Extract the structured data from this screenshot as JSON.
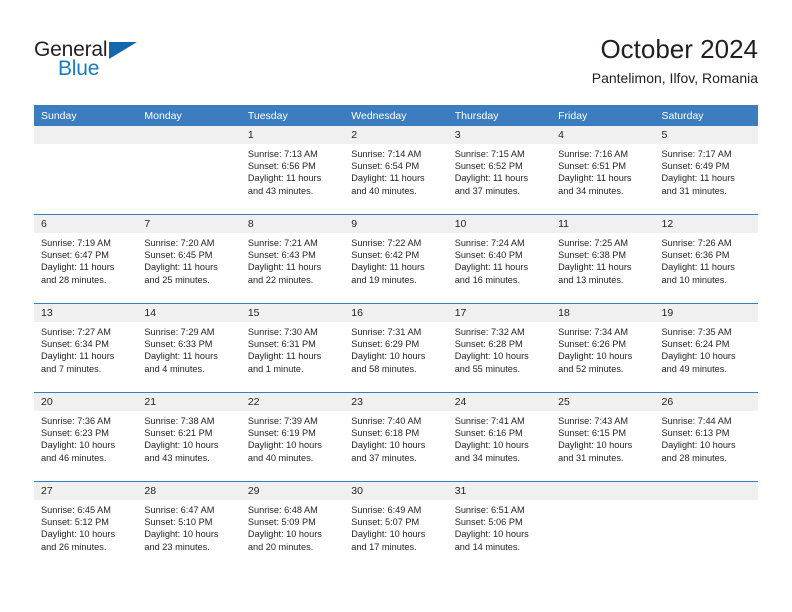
{
  "brand": {
    "name_part1": "General",
    "name_part2": "Blue",
    "accent_color": "#1267ad",
    "text_color": "#231f20"
  },
  "header": {
    "title": "October 2024",
    "subtitle": "Pantelimon, Ilfov, Romania"
  },
  "calendar": {
    "header_bg": "#3b7dbf",
    "daynum_bg": "#f0f0f0",
    "weekdays": [
      "Sunday",
      "Monday",
      "Tuesday",
      "Wednesday",
      "Thursday",
      "Friday",
      "Saturday"
    ],
    "weeks": [
      [
        {
          "day": "",
          "blank": true
        },
        {
          "day": "",
          "blank": true
        },
        {
          "day": "1",
          "sunrise": "Sunrise: 7:13 AM",
          "sunset": "Sunset: 6:56 PM",
          "daylight1": "Daylight: 11 hours",
          "daylight2": "and 43 minutes."
        },
        {
          "day": "2",
          "sunrise": "Sunrise: 7:14 AM",
          "sunset": "Sunset: 6:54 PM",
          "daylight1": "Daylight: 11 hours",
          "daylight2": "and 40 minutes."
        },
        {
          "day": "3",
          "sunrise": "Sunrise: 7:15 AM",
          "sunset": "Sunset: 6:52 PM",
          "daylight1": "Daylight: 11 hours",
          "daylight2": "and 37 minutes."
        },
        {
          "day": "4",
          "sunrise": "Sunrise: 7:16 AM",
          "sunset": "Sunset: 6:51 PM",
          "daylight1": "Daylight: 11 hours",
          "daylight2": "and 34 minutes."
        },
        {
          "day": "5",
          "sunrise": "Sunrise: 7:17 AM",
          "sunset": "Sunset: 6:49 PM",
          "daylight1": "Daylight: 11 hours",
          "daylight2": "and 31 minutes."
        }
      ],
      [
        {
          "day": "6",
          "sunrise": "Sunrise: 7:19 AM",
          "sunset": "Sunset: 6:47 PM",
          "daylight1": "Daylight: 11 hours",
          "daylight2": "and 28 minutes."
        },
        {
          "day": "7",
          "sunrise": "Sunrise: 7:20 AM",
          "sunset": "Sunset: 6:45 PM",
          "daylight1": "Daylight: 11 hours",
          "daylight2": "and 25 minutes."
        },
        {
          "day": "8",
          "sunrise": "Sunrise: 7:21 AM",
          "sunset": "Sunset: 6:43 PM",
          "daylight1": "Daylight: 11 hours",
          "daylight2": "and 22 minutes."
        },
        {
          "day": "9",
          "sunrise": "Sunrise: 7:22 AM",
          "sunset": "Sunset: 6:42 PM",
          "daylight1": "Daylight: 11 hours",
          "daylight2": "and 19 minutes."
        },
        {
          "day": "10",
          "sunrise": "Sunrise: 7:24 AM",
          "sunset": "Sunset: 6:40 PM",
          "daylight1": "Daylight: 11 hours",
          "daylight2": "and 16 minutes."
        },
        {
          "day": "11",
          "sunrise": "Sunrise: 7:25 AM",
          "sunset": "Sunset: 6:38 PM",
          "daylight1": "Daylight: 11 hours",
          "daylight2": "and 13 minutes."
        },
        {
          "day": "12",
          "sunrise": "Sunrise: 7:26 AM",
          "sunset": "Sunset: 6:36 PM",
          "daylight1": "Daylight: 11 hours",
          "daylight2": "and 10 minutes."
        }
      ],
      [
        {
          "day": "13",
          "sunrise": "Sunrise: 7:27 AM",
          "sunset": "Sunset: 6:34 PM",
          "daylight1": "Daylight: 11 hours",
          "daylight2": "and 7 minutes."
        },
        {
          "day": "14",
          "sunrise": "Sunrise: 7:29 AM",
          "sunset": "Sunset: 6:33 PM",
          "daylight1": "Daylight: 11 hours",
          "daylight2": "and 4 minutes."
        },
        {
          "day": "15",
          "sunrise": "Sunrise: 7:30 AM",
          "sunset": "Sunset: 6:31 PM",
          "daylight1": "Daylight: 11 hours",
          "daylight2": "and 1 minute."
        },
        {
          "day": "16",
          "sunrise": "Sunrise: 7:31 AM",
          "sunset": "Sunset: 6:29 PM",
          "daylight1": "Daylight: 10 hours",
          "daylight2": "and 58 minutes."
        },
        {
          "day": "17",
          "sunrise": "Sunrise: 7:32 AM",
          "sunset": "Sunset: 6:28 PM",
          "daylight1": "Daylight: 10 hours",
          "daylight2": "and 55 minutes."
        },
        {
          "day": "18",
          "sunrise": "Sunrise: 7:34 AM",
          "sunset": "Sunset: 6:26 PM",
          "daylight1": "Daylight: 10 hours",
          "daylight2": "and 52 minutes."
        },
        {
          "day": "19",
          "sunrise": "Sunrise: 7:35 AM",
          "sunset": "Sunset: 6:24 PM",
          "daylight1": "Daylight: 10 hours",
          "daylight2": "and 49 minutes."
        }
      ],
      [
        {
          "day": "20",
          "sunrise": "Sunrise: 7:36 AM",
          "sunset": "Sunset: 6:23 PM",
          "daylight1": "Daylight: 10 hours",
          "daylight2": "and 46 minutes."
        },
        {
          "day": "21",
          "sunrise": "Sunrise: 7:38 AM",
          "sunset": "Sunset: 6:21 PM",
          "daylight1": "Daylight: 10 hours",
          "daylight2": "and 43 minutes."
        },
        {
          "day": "22",
          "sunrise": "Sunrise: 7:39 AM",
          "sunset": "Sunset: 6:19 PM",
          "daylight1": "Daylight: 10 hours",
          "daylight2": "and 40 minutes."
        },
        {
          "day": "23",
          "sunrise": "Sunrise: 7:40 AM",
          "sunset": "Sunset: 6:18 PM",
          "daylight1": "Daylight: 10 hours",
          "daylight2": "and 37 minutes."
        },
        {
          "day": "24",
          "sunrise": "Sunrise: 7:41 AM",
          "sunset": "Sunset: 6:16 PM",
          "daylight1": "Daylight: 10 hours",
          "daylight2": "and 34 minutes."
        },
        {
          "day": "25",
          "sunrise": "Sunrise: 7:43 AM",
          "sunset": "Sunset: 6:15 PM",
          "daylight1": "Daylight: 10 hours",
          "daylight2": "and 31 minutes."
        },
        {
          "day": "26",
          "sunrise": "Sunrise: 7:44 AM",
          "sunset": "Sunset: 6:13 PM",
          "daylight1": "Daylight: 10 hours",
          "daylight2": "and 28 minutes."
        }
      ],
      [
        {
          "day": "27",
          "sunrise": "Sunrise: 6:45 AM",
          "sunset": "Sunset: 5:12 PM",
          "daylight1": "Daylight: 10 hours",
          "daylight2": "and 26 minutes."
        },
        {
          "day": "28",
          "sunrise": "Sunrise: 6:47 AM",
          "sunset": "Sunset: 5:10 PM",
          "daylight1": "Daylight: 10 hours",
          "daylight2": "and 23 minutes."
        },
        {
          "day": "29",
          "sunrise": "Sunrise: 6:48 AM",
          "sunset": "Sunset: 5:09 PM",
          "daylight1": "Daylight: 10 hours",
          "daylight2": "and 20 minutes."
        },
        {
          "day": "30",
          "sunrise": "Sunrise: 6:49 AM",
          "sunset": "Sunset: 5:07 PM",
          "daylight1": "Daylight: 10 hours",
          "daylight2": "and 17 minutes."
        },
        {
          "day": "31",
          "sunrise": "Sunrise: 6:51 AM",
          "sunset": "Sunset: 5:06 PM",
          "daylight1": "Daylight: 10 hours",
          "daylight2": "and 14 minutes."
        },
        {
          "day": "",
          "blank": true
        },
        {
          "day": "",
          "blank": true
        }
      ]
    ]
  }
}
